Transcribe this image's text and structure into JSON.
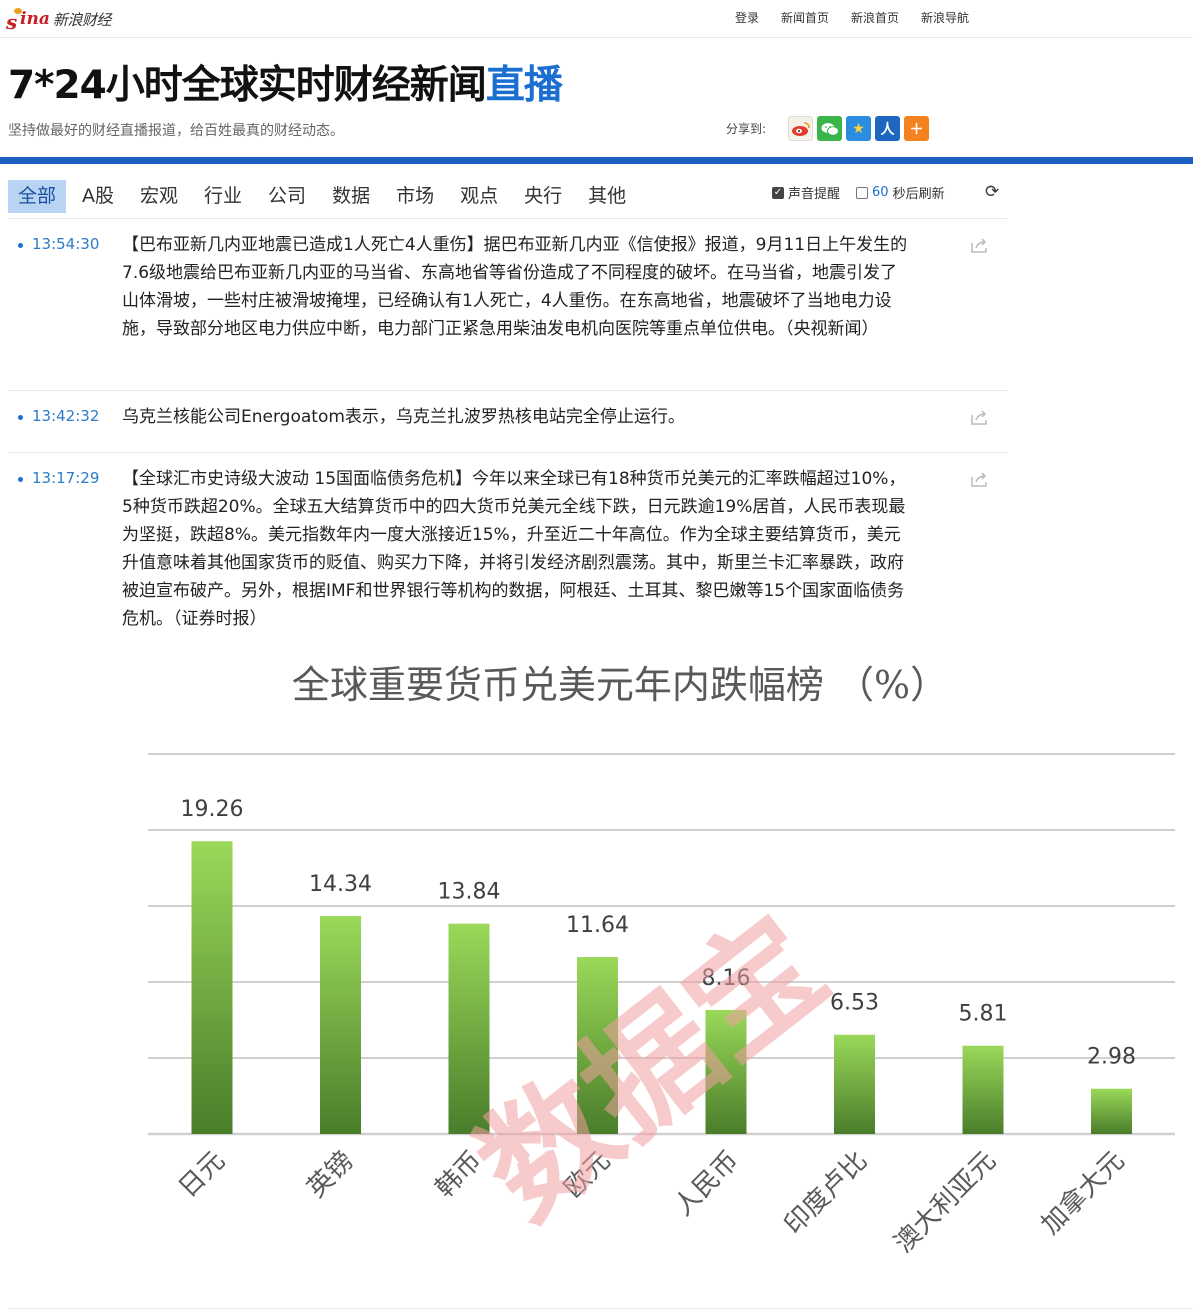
{
  "header": {
    "logo_brand": "sina",
    "logo_text": "新浪财经",
    "nav": [
      "登录",
      "新闻首页",
      "新浪首页",
      "新浪导航"
    ]
  },
  "title": {
    "prefix": "7*24小时全球实时财经新闻",
    "highlight": "直播"
  },
  "subtitle": "坚持做最好的财经直播报道，给百姓最真的财经动态。",
  "share": {
    "label": "分享到:",
    "icons": [
      "weibo-icon",
      "wechat-icon",
      "qzone-icon",
      "renren-icon",
      "more-icon"
    ]
  },
  "tabs": [
    {
      "label": "全部",
      "active": true
    },
    {
      "label": "A股"
    },
    {
      "label": "宏观"
    },
    {
      "label": "行业"
    },
    {
      "label": "公司"
    },
    {
      "label": "数据"
    },
    {
      "label": "市场"
    },
    {
      "label": "观点"
    },
    {
      "label": "央行"
    },
    {
      "label": "其他"
    }
  ],
  "options": {
    "sound_label": "声音提醒",
    "sound_checked": true,
    "refresh_seconds": "60",
    "refresh_label": "秒后刷新",
    "refresh_checked": false
  },
  "colors": {
    "accent": "#1a6fd1",
    "rule": "#1a5fbf",
    "tab_active_bg": "#b8d4f2"
  },
  "news": [
    {
      "time": "13:54:30",
      "text": "【巴布亚新几内亚地震已造成1人死亡4人重伤】据巴布亚新几内亚《信使报》报道，9月11日上午发生的7.6级地震给巴布亚新几内亚的马当省、东高地省等省份造成了不同程度的破坏。在马当省，地震引发了山体滑坡，一些村庄被滑坡掩埋，已经确认有1人死亡，4人重伤。在东高地省，地震破坏了当地电力设施，导致部分地区电力供应中断，电力部门正紧急用柴油发电机向医院等重点单位供电。（央视新闻）"
    },
    {
      "time": "13:42:32",
      "text": "乌克兰核能公司Energoatom表示，乌克兰扎波罗热核电站完全停止运行。"
    },
    {
      "time": "13:17:29",
      "text": "【全球汇市史诗级大波动 15国面临债务危机】今年以来全球已有18种货币兑美元的汇率跌幅超过10%，5种货币跌超20%。全球五大结算货币中的四大货币兑美元全线下跌，日元跌逾19%居首，人民币表现最为坚挺，跌超8%。美元指数年内一度大涨接近15%，升至近二十年高位。作为全球主要结算货币，美元升值意味着其他国家货币的贬值、购买力下降，并将引发经济剧烈震荡。其中，斯里兰卡汇率暴跌，政府被迫宣布破产。另外，根据IMF和世界银行等机构的数据，阿根廷、土耳其、黎巴嫩等15个国家面临债务危机。（证券时报）"
    }
  ],
  "chart_data": {
    "type": "bar",
    "title": "全球重要货币兑美元年内跌幅榜 （%）",
    "categories": [
      "日元",
      "英镑",
      "韩币",
      "欧元",
      "人民币",
      "印度卢比",
      "澳大利亚元",
      "加拿大元"
    ],
    "values": [
      19.26,
      14.34,
      13.84,
      11.64,
      8.16,
      6.53,
      5.81,
      2.98
    ],
    "value_labels": [
      "19.26",
      "14.34",
      "13.84",
      "11.64",
      "8.16",
      "6.53",
      "5.81",
      "2.98"
    ],
    "ylim": [
      0,
      25
    ],
    "grid": true,
    "legend": "none",
    "watermark": "数据宝",
    "bar_color_top": "#9ad95a",
    "bar_color_bottom": "#4a7d2a"
  }
}
